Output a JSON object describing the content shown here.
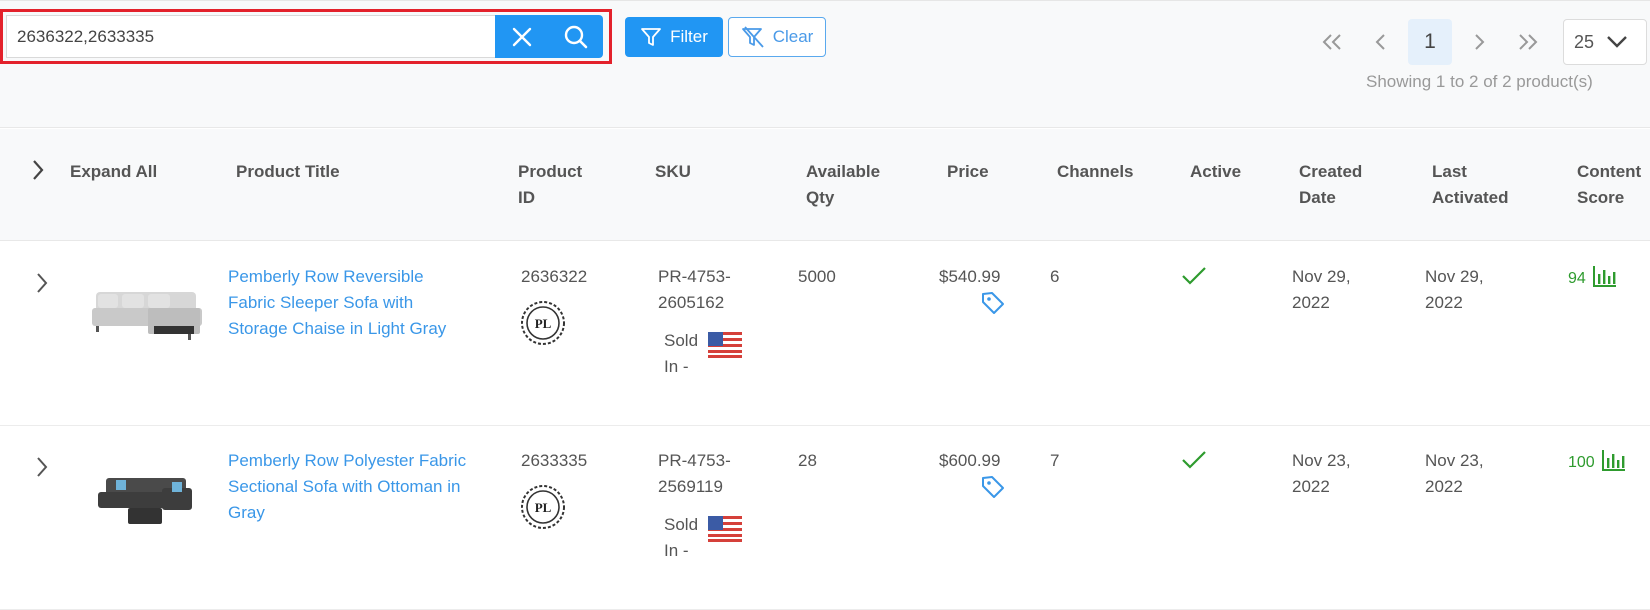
{
  "search": {
    "value": "2636322,2633335"
  },
  "toolbar": {
    "filter_label": "Filter",
    "clear_label": "Clear"
  },
  "pagination": {
    "current_page": "1",
    "per_page": "25",
    "showing": "Showing 1 to 2 of 2 product(s)"
  },
  "table": {
    "headers": {
      "expand_all": "Expand All",
      "product_title": "Product Title",
      "product_id_line1": "Product",
      "product_id_line2": "ID",
      "sku": "SKU",
      "qty_line1": "Available",
      "qty_line2": "Qty",
      "price": "Price",
      "channels": "Channels",
      "active": "Active",
      "created_line1": "Created",
      "created_line2": "Date",
      "last_line1": "Last",
      "last_line2": "Activated",
      "score_line1": "Content",
      "score_line2": "Score"
    },
    "rows": [
      {
        "title_lines": [
          "Pemberly Row Reversible",
          "Fabric Sleeper Sofa with",
          "Storage Chaise in Light Gray"
        ],
        "product_id": "2636322",
        "badge": "PL",
        "sku_line1": "PR-4753-",
        "sku_line2": "2605162",
        "sold_in_line1": "Sold",
        "sold_in_line2": "In -",
        "qty": "5000",
        "price": "$540.99",
        "channels": "6",
        "created_line1": "Nov 29,",
        "created_line2": "2022",
        "last_line1": "Nov 29,",
        "last_line2": "2022",
        "score": "94"
      },
      {
        "title_lines": [
          "Pemberly Row Polyester Fabric",
          "Sectional Sofa with Ottoman in",
          "Gray"
        ],
        "product_id": "2633335",
        "badge": "PL",
        "sku_line1": "PR-4753-",
        "sku_line2": "2569119",
        "sold_in_line1": "Sold",
        "sold_in_line2": "In -",
        "qty": "28",
        "price": "$600.99",
        "channels": "7",
        "created_line1": "Nov 23,",
        "created_line2": "2022",
        "last_line1": "Nov 23,",
        "last_line2": "2022",
        "score": "100"
      }
    ]
  },
  "icons": [
    "close-icon",
    "search-icon",
    "filter-icon",
    "filter-clear-icon",
    "first-page-icon",
    "prev-page-icon",
    "next-page-icon",
    "last-page-icon",
    "chevron-down-icon",
    "chevron-right-icon",
    "sofa-thumbnail",
    "pl-badge-icon",
    "us-flag-icon",
    "price-tag-icon",
    "check-icon",
    "bar-chart-icon"
  ],
  "colors": {
    "accent": "#2196f3",
    "highlight": "#e3212b",
    "link": "#3a97e8",
    "success": "#2e9b2e"
  }
}
